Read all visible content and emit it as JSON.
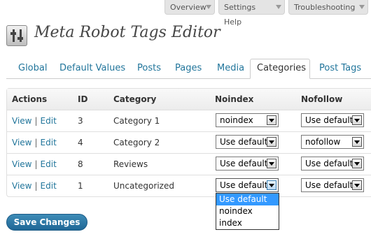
{
  "screen_meta": {
    "overview": "Overview",
    "settings_help": "Settings Help",
    "troubleshooting": "Troubleshooting"
  },
  "page_title": "Meta Robot Tags Editor",
  "tabs": [
    "Global",
    "Default Values",
    "Posts",
    "Pages",
    "Media",
    "Categories",
    "Post Tags"
  ],
  "active_tab": "Categories",
  "table": {
    "headers": {
      "actions": "Actions",
      "id": "ID",
      "category": "Category",
      "noindex": "Noindex",
      "nofollow": "Nofollow"
    },
    "action_view": "View",
    "action_sep": "|",
    "action_edit": "Edit",
    "rows": [
      {
        "id": "3",
        "category": "Category 1",
        "noindex": "noindex",
        "nofollow": "Use default"
      },
      {
        "id": "4",
        "category": "Category 2",
        "noindex": "Use default",
        "nofollow": "nofollow"
      },
      {
        "id": "8",
        "category": "Reviews",
        "noindex": "Use default",
        "nofollow": "Use default"
      },
      {
        "id": "1",
        "category": "Uncategorized",
        "noindex": "Use default",
        "nofollow": "Use default"
      }
    ]
  },
  "dropdown_options": [
    "Use default",
    "noindex",
    "index"
  ],
  "dropdown_highlighted": "Use default",
  "save_button": "Save Changes",
  "colors": {
    "link": "#21759b",
    "button": "#2a7aab",
    "highlight": "#3399ff"
  }
}
